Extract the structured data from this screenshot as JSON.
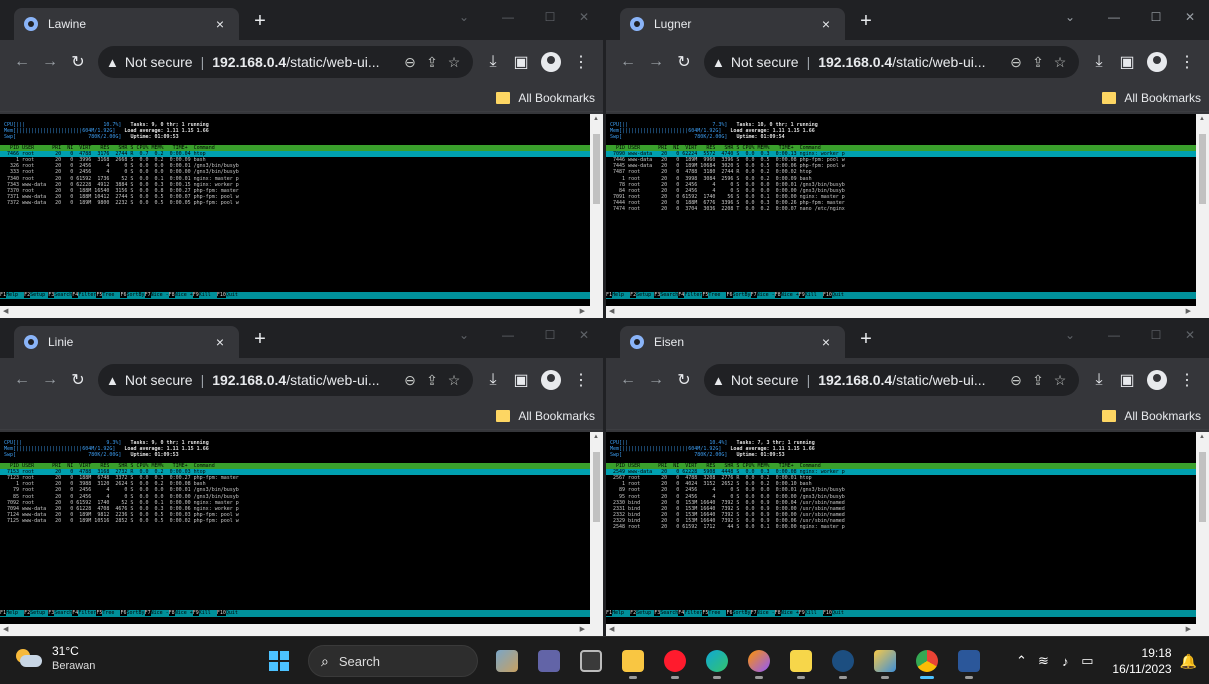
{
  "windows": [
    {
      "tab_title": "Lawine",
      "htop": {
        "cpu": "CPU[|||                          10.7%]",
        "mem": "Mem[||||||||||||||||||||||604M/1.92G]",
        "swp": "Swp[                        780K/2.00G]",
        "tasks": "Tasks: 9, 0 thr; 1 running",
        "load": "Load average: 1.11 1.15 1.66",
        "uptime": "Uptime: 01:09:53",
        "colhdr": "  PID USER      PRI  NI  VIRT   RES   SHR S CPU% MEM%   TIME+  Command",
        "sel": " 7466 root       20   0  4788  3176  2744 R  0.7  0.2  0:00.04 htop",
        "rows": [
          "    1 root       20   0  3996  3168  2668 S  0.0  0.2  0:00.09 bash",
          "  326 root       20   0  2456     4     0 S  0.0  0.0  0:00.01 /gns3/bin/busyb",
          "  333 root       20   0  2456     4     0 S  0.0  0.0  0:00.00 /gns3/bin/busyb",
          " 7340 root       20   0 61592  1736    52 S  0.0  0.1  0:00.01 nginx: master p",
          " 7343 www-data   20   0 62228  4912  3884 S  0.0  0.3  0:00.15 nginx: worker p",
          " 7370 root       20   0  188M 16540  3156 S  0.0  0.8  0:00.27 php-fpm: master",
          " 7371 www-data   20   0  188M 10412  2744 S  0.0  0.5  0:00.07 php-fpm: pool w",
          " 7372 www-data   20   0  189M  9800  2232 S  0.0  0.5  0:00.05 php-fpm: pool w"
        ]
      }
    },
    {
      "tab_title": "Lugner",
      "htop": {
        "cpu": "CPU[||                            7.3%]",
        "mem": "Mem[||||||||||||||||||||||604M/1.92G]",
        "swp": "Swp[                        780K/2.00G]",
        "tasks": "Tasks: 10, 0 thr; 1 running",
        "load": "Load average: 1.11 1.15 1.66",
        "uptime": "Uptime: 01:09:54",
        "colhdr": "  PID USER      PRI  NI  VIRT   RES   SHR S CPU% MEM%   TIME+  Command",
        "sel": " 7090 www-data   20   0 62224  5572  4740 S  0.0  0.3  0:00.13 nginx: worker p",
        "rows": [
          " 7446 www-data   20   0  189M  9960  3396 S  0.0  0.5  0:00.08 php-fpm: pool w",
          " 7445 www-data   20   0  189M 10684  3020 S  0.0  0.5  0:00.06 php-fpm: pool w",
          " 7487 root       20   0  4788  3180  2744 R  0.0  0.2  0:00.02 htop",
          "    1 root       20   0  3998  3084  2596 S  0.0  0.2  0:00.09 bash",
          "   78 root       20   0  2456     4     0 S  0.0  0.0  0:00.01 /gns3/bin/busyb",
          "   84 root       20   0  2456     4     0 S  0.0  0.0  0:00.00 /gns3/bin/busyb",
          " 7091 root       20   0 61592  1740    56 S  0.0  0.1  0:00.00 nginx: master p",
          " 7444 root       20   0  188M  6776  3396 S  0.0  0.3  0:00.26 php-fpm: master",
          " 7474 root       20   0  3704  3036  2208 T  0.0  0.2  0:00.07 nano /etc/nginx"
        ]
      }
    },
    {
      "tab_title": "Linie",
      "htop": {
        "cpu": "CPU[||                            9.3%]",
        "mem": "Mem[||||||||||||||||||||||604M/1.92G]",
        "swp": "Swp[                        780K/2.00G]",
        "tasks": "Tasks: 9, 0 thr; 1 running",
        "load": "Load average: 1.11 1.15 1.66",
        "uptime": "Uptime: 01:09:53",
        "colhdr": "  PID USER      PRI  NI  VIRT   RES   SHR S CPU% MEM%   TIME+  Command",
        "sel": " 7153 root       20   0  4788  3168  2732 R  0.0  0.2  0:00.03 htop",
        "rows": [
          " 7123 root       20   0  188M  6748  3372 S  0.0  0.3  0:00.27 php-fpm: master",
          "    1 root       20   0  3988  3120  2624 S  0.0  0.2  0:00.08 bash",
          "   79 root       20   0  2456     4     0 S  0.0  0.0  0:00.01 /gns3/bin/busyb",
          "   85 root       20   0  2456     4     0 S  0.0  0.0  0:00.00 /gns3/bin/busyb",
          " 7092 root       20   0 61592  1740    52 S  0.0  0.1  0:00.00 nginx: master p",
          " 7094 www-data   20   0 61228  4708  4676 S  0.0  0.3  0:00.06 nginx: worker p",
          " 7124 www-data   20   0  189M  9812  2236 S  0.0  0.5  0:00.03 php-fpm: pool w",
          " 7125 www-data   20   0  189M 10516  2852 S  0.0  0.5  0:00.02 php-fpm: pool w"
        ]
      }
    },
    {
      "tab_title": "Eisen",
      "htop": {
        "cpu": "CPU[||                           10.4%]",
        "mem": "Mem[||||||||||||||||||||||604M/1.92G]",
        "swp": "Swp[                        780K/2.00G]",
        "tasks": "Tasks: 7, 3 thr; 1 running",
        "load": "Load average: 1.11 1.15 1.66",
        "uptime": "Uptime: 01:09:53",
        "colhdr": "  PID USER      PRI  NI  VIRT   RES   SHR S CPU% MEM%   TIME+  Command",
        "sel": " 2549 www-data   20   0 62228  5908  4448 S  0.0  0.3  0:00.08 nginx: worker p",
        "rows": [
          " 2567 root       20   0  4788  3208  2776 R  0.0  0.2  0:00.01 htop",
          "    1 root       20   0  4024  3152  2652 S  0.0  0.2  0:00.10 bash",
          "   89 root       20   0  2456     4     0 S  0.0  0.0  0:00.01 /gns3/bin/busyb",
          "   95 root       20   0  2456     4     0 S  0.0  0.0  0:00.00 /gns3/bin/busyb",
          " 2330 bind       20   0  153M 16640  7392 S  0.0  0.9  0:00.04 /usr/sbin/named",
          " 2331 bind       20   0  153M 16640  7392 S  0.0  0.9  0:00.00 /usr/sbin/named",
          " 2332 bind       20   0  153M 16640  7392 S  0.0  0.9  0:00.00 /usr/sbin/named",
          " 2329 bind       20   0  153M 16640  7392 S  0.0  0.9  0:00.06 /usr/sbin/named",
          " 2548 root       20   0 61592  1712    44 S  0.0  0.1  0:00.00 nginx: master p"
        ]
      }
    }
  ],
  "browser": {
    "secure_label": "Not secure",
    "url_bold": "192.168.0.4",
    "url_rest": "/static/web-ui...",
    "bookmarks_label": "All Bookmarks",
    "tab_close": "×",
    "new_tab": "+"
  },
  "htop_fkeys": [
    {
      "k": "F1",
      "label": "Help  "
    },
    {
      "k": "F2",
      "label": "Setup "
    },
    {
      "k": "F3",
      "label": "Search"
    },
    {
      "k": "F4",
      "label": "Filter"
    },
    {
      "k": "F5",
      "label": "Tree  "
    },
    {
      "k": "F6",
      "label": "SortBy"
    },
    {
      "k": "F7",
      "label": "Nice -"
    },
    {
      "k": "F8",
      "label": "Nice +"
    },
    {
      "k": "F9",
      "label": "Kill  "
    },
    {
      "k": "F10",
      "label": "Quit  "
    }
  ],
  "taskbar": {
    "weather_temp": "31°C",
    "weather_cond": "Berawan",
    "search_label": "Search",
    "time": "19:18",
    "date": "16/11/2023"
  },
  "colors": {
    "htop_selected": "#00a0b0",
    "htop_header": "#3aa02c",
    "htop_fkeys_bar": "#00909a",
    "taskbar_accent": "#4cc2ff"
  }
}
